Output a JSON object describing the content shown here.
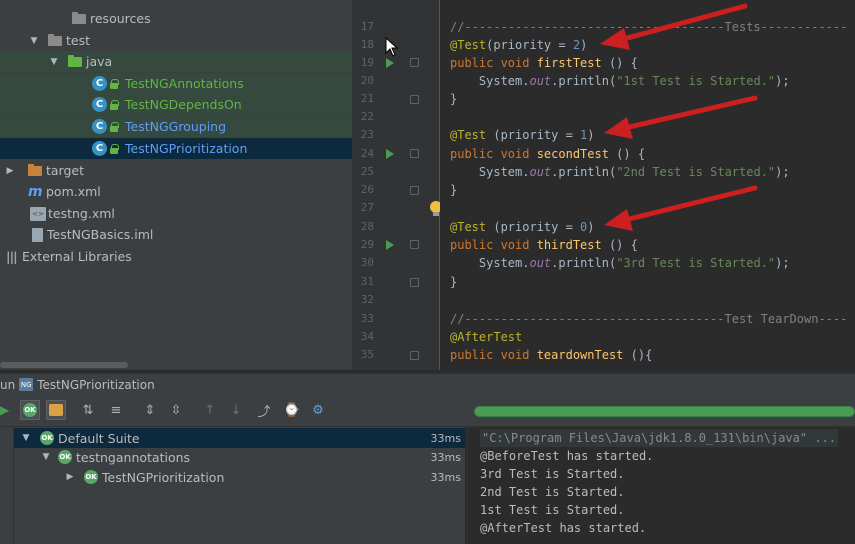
{
  "project_tree": {
    "items": [
      {
        "label": "resources",
        "kind": "folder"
      },
      {
        "label": "test",
        "kind": "folder"
      },
      {
        "label": "java",
        "kind": "source-folder"
      },
      {
        "label": "TestNGAnnotations",
        "kind": "class"
      },
      {
        "label": "TestNGDependsOn",
        "kind": "class"
      },
      {
        "label": "TestNGGrouping",
        "kind": "class"
      },
      {
        "label": "TestNGPrioritization",
        "kind": "class"
      },
      {
        "label": "target",
        "kind": "folder"
      },
      {
        "label": "pom.xml",
        "kind": "maven"
      },
      {
        "label": "testng.xml",
        "kind": "xml"
      },
      {
        "label": "TestNGBasics.iml",
        "kind": "iml"
      },
      {
        "label": "External Libraries",
        "kind": "libraries"
      }
    ]
  },
  "editor": {
    "line_numbers": [
      "17",
      "18",
      "19",
      "20",
      "21",
      "22",
      "23",
      "24",
      "25",
      "26",
      "27",
      "28",
      "29",
      "30",
      "31",
      "32",
      "33",
      "34",
      "35"
    ],
    "lines": {
      "l17": "//------------------------------------Tests------------",
      "l18_anno": "@Test",
      "l18_rest": "(priority = ",
      "l18_num": "2",
      "l18_close": ")",
      "l19_kw": "public void ",
      "l19_fn": "firstTest",
      "l19_rest": " () {",
      "l20_a": "    System.",
      "l20_out": "out",
      "l20_b": ".println(",
      "l20_str": "\"1st Test is Started.\"",
      "l20_c": ");",
      "l21": "}",
      "l23_anno": "@Test",
      "l23_rest": " (priority = ",
      "l23_num": "1",
      "l23_close": ")",
      "l24_kw": "public void ",
      "l24_fn": "secondTest",
      "l24_rest": " () {",
      "l25_a": "    System.",
      "l25_out": "out",
      "l25_b": ".println(",
      "l25_str": "\"2nd Test is Started.\"",
      "l25_c": ");",
      "l26": "}",
      "l28_anno": "@Test",
      "l28_rest": " (priority = ",
      "l28_num": "0",
      "l28_close": ")",
      "l29_kw": "public void ",
      "l29_fn": "thirdTest",
      "l29_rest": " () {",
      "l30_a": "    System.",
      "l30_out": "out",
      "l30_b": ".println(",
      "l30_str": "\"3rd Test is Started.\"",
      "l30_c": ");",
      "l31": "}",
      "l33": "//------------------------------------Test TearDown----",
      "l34_anno": "@AfterTest",
      "l35_kw": "public void ",
      "l35_fn": "teardownTest",
      "l35_rest": " (){"
    }
  },
  "run_window": {
    "tab_prefix": "un",
    "tab_title": "TestNGPrioritization",
    "results": [
      {
        "label": "Default Suite",
        "time": "33ms"
      },
      {
        "label": "testngannotations",
        "time": "33ms"
      },
      {
        "label": "TestNGPrioritization",
        "time": "33ms"
      }
    ],
    "ok_badge": "OK",
    "progress_percent": 100,
    "console": [
      "\"C:\\Program Files\\Java\\jdk1.8.0_131\\bin\\java\" ...",
      "@BeforeTest has started.",
      "3rd Test is Started.",
      "2nd Test is Started.",
      "1st Test is Started.",
      "@AfterTest has started."
    ]
  },
  "colors": {
    "accent_arrow": "#cc1f1f",
    "passed_green": "#59a869",
    "selection": "#0d293e"
  }
}
